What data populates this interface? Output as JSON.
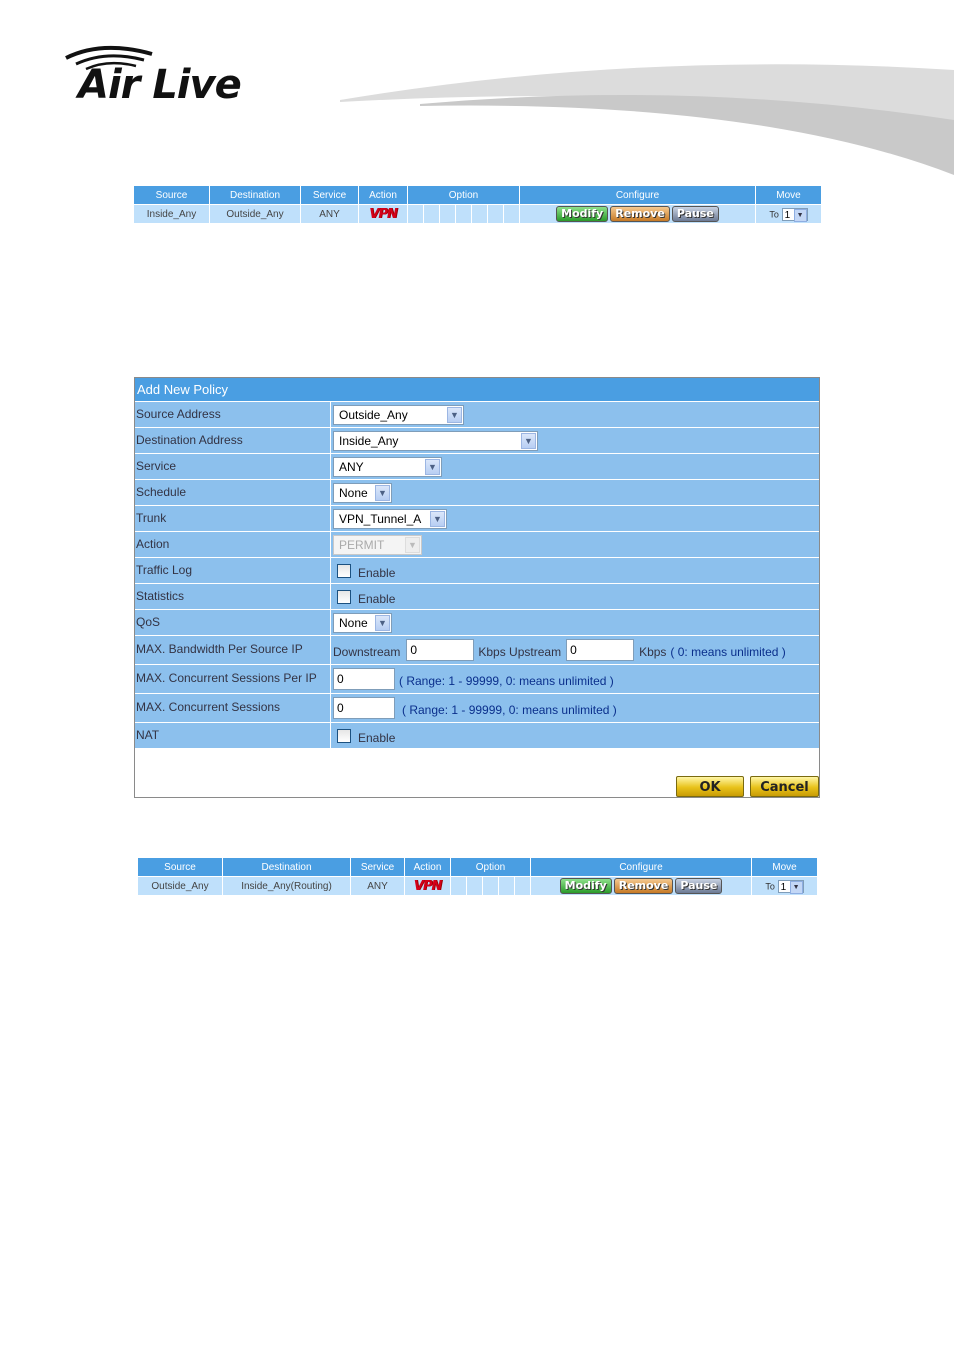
{
  "brand": {
    "name": "Air Live"
  },
  "policy_table_1": {
    "headers": [
      "Source",
      "Destination",
      "Service",
      "Action",
      "Option",
      "Configure",
      "Move"
    ],
    "row": {
      "source": "Inside_Any",
      "destination": "Outside_Any",
      "service": "ANY",
      "action": "VPN",
      "modify": "Modify",
      "remove": "Remove",
      "pause": "Pause",
      "to": "To",
      "move_value": "1"
    }
  },
  "form": {
    "title": "Add New Policy",
    "source_address": {
      "label": "Source Address",
      "value": "Outside_Any"
    },
    "destination_address": {
      "label": "Destination Address",
      "value": "Inside_Any"
    },
    "service": {
      "label": "Service",
      "value": "ANY"
    },
    "schedule": {
      "label": "Schedule",
      "value": "None"
    },
    "trunk": {
      "label": "Trunk",
      "value": "VPN_Tunnel_A"
    },
    "action": {
      "label": "Action",
      "value": "PERMIT"
    },
    "traffic_log": {
      "label": "Traffic Log",
      "option": "Enable"
    },
    "statistics": {
      "label": "Statistics",
      "option": "Enable"
    },
    "qos": {
      "label": "QoS",
      "value": "None"
    },
    "max_bandwidth": {
      "label": "MAX. Bandwidth Per Source IP",
      "downstream_label": "Downstream",
      "downstream_value": "0",
      "upstream_label": "Kbps Upstream",
      "upstream_value": "0",
      "unit": "Kbps",
      "hint": "( 0: means unlimited )"
    },
    "max_sessions_per_ip": {
      "label": "MAX. Concurrent Sessions Per IP",
      "value": "0",
      "hint": "( Range: 1 - 99999, 0: means unlimited )"
    },
    "max_sessions": {
      "label": "MAX. Concurrent Sessions",
      "value": "0",
      "hint": "( Range: 1 - 99999, 0: means unlimited )"
    },
    "nat": {
      "label": "NAT",
      "option": "Enable"
    },
    "ok_label": "OK",
    "cancel_label": "Cancel"
  },
  "policy_table_2": {
    "headers": [
      "Source",
      "Destination",
      "Service",
      "Action",
      "Option",
      "Configure",
      "Move"
    ],
    "row": {
      "source": "Outside_Any",
      "destination": "Inside_Any(Routing)",
      "service": "ANY",
      "action": "VPN",
      "modify": "Modify",
      "remove": "Remove",
      "pause": "Pause",
      "to": "To",
      "move_value": "1"
    }
  }
}
